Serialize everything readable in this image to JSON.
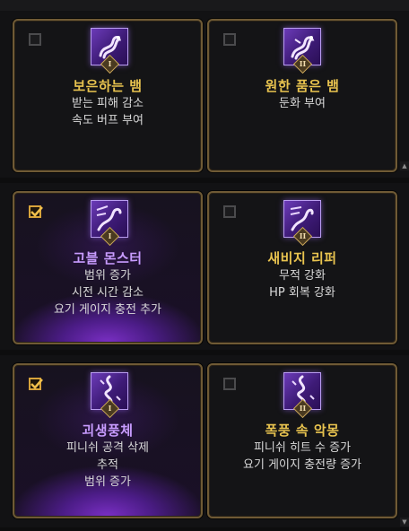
{
  "cards": [
    {
      "title": "보은하는 뱀",
      "checked": false,
      "tier": "I",
      "desc": [
        "받는 피해 감소",
        "속도 버프 부여"
      ]
    },
    {
      "title": "원한 품은 뱀",
      "checked": false,
      "tier": "II",
      "desc": [
        "둔화 부여"
      ]
    },
    {
      "title": "고블 몬스터",
      "checked": true,
      "tier": "I",
      "desc": [
        "범위 증가",
        "시전 시간 감소",
        "요기 게이지 충전 추가"
      ]
    },
    {
      "title": "새비지 리퍼",
      "checked": false,
      "tier": "II",
      "desc": [
        "무적 강화",
        "HP 회복 강화"
      ]
    },
    {
      "title": "괴생풍체",
      "checked": true,
      "tier": "I",
      "desc": [
        "피니쉬 공격 삭제",
        "추적",
        "범위 증가"
      ]
    },
    {
      "title": "폭풍 속 악몽",
      "checked": false,
      "tier": "II",
      "desc": [
        "피니쉬 히트 수 증가",
        "요기 게이지 충전량 증가"
      ]
    }
  ],
  "icons": {
    "checkbox_check": "check-icon",
    "skill_icon": "serpent-skill-icon",
    "scroll_up": "scroll-up-icon",
    "scroll_down": "scroll-down-icon"
  },
  "colors": {
    "title_gold": "#e8c34f",
    "title_purple": "#c89cff",
    "border_gold": "#6f5a35",
    "check_gold": "#d7a33b",
    "selected_glow": "#7a2fc4"
  }
}
